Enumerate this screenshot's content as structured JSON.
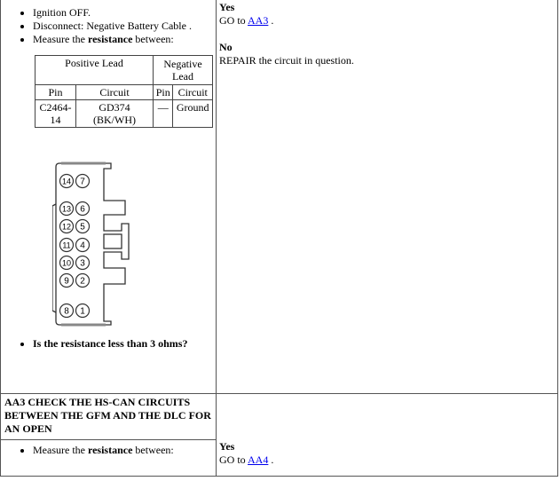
{
  "step_aa2": {
    "instructions": [
      "Ignition OFF.",
      "Disconnect: Negative Battery Cable ."
    ],
    "measure_prefix": "Measure the ",
    "measure_bold": "resistance",
    "measure_suffix": " between:",
    "table": {
      "header_positive": "Positive Lead",
      "header_negative": "Negative Lead",
      "sub_pin": "Pin",
      "sub_circuit": "Circuit",
      "sub_pin2": "Pin",
      "sub_circuit2": "Circuit",
      "rows": [
        {
          "pos_pin": "C2464-14",
          "pos_circuit": "GD374 (BK/WH)",
          "neg_pin": "—",
          "neg_circuit": "Ground"
        }
      ]
    },
    "connector_pins": {
      "left": [
        "14",
        "13",
        "12",
        "11",
        "10",
        "9",
        "8"
      ],
      "right": [
        "7",
        "6",
        "5",
        "4",
        "3",
        "2",
        "1"
      ]
    },
    "question": "Is the resistance less than 3 ohms?",
    "yes_label": "Yes",
    "yes_text": "GO to ",
    "yes_link": "AA3",
    "yes_after": " .",
    "no_label": "No",
    "no_text": "REPAIR the circuit in question."
  },
  "step_aa3": {
    "heading": "AA3 CHECK THE HS-CAN CIRCUITS BETWEEN THE GFM AND THE DLC FOR AN OPEN",
    "measure_prefix": "Measure the ",
    "measure_bold": "resistance",
    "measure_suffix": " between:",
    "yes_label": "Yes",
    "yes_text": "GO to ",
    "yes_link": "AA4",
    "yes_after": " ."
  }
}
